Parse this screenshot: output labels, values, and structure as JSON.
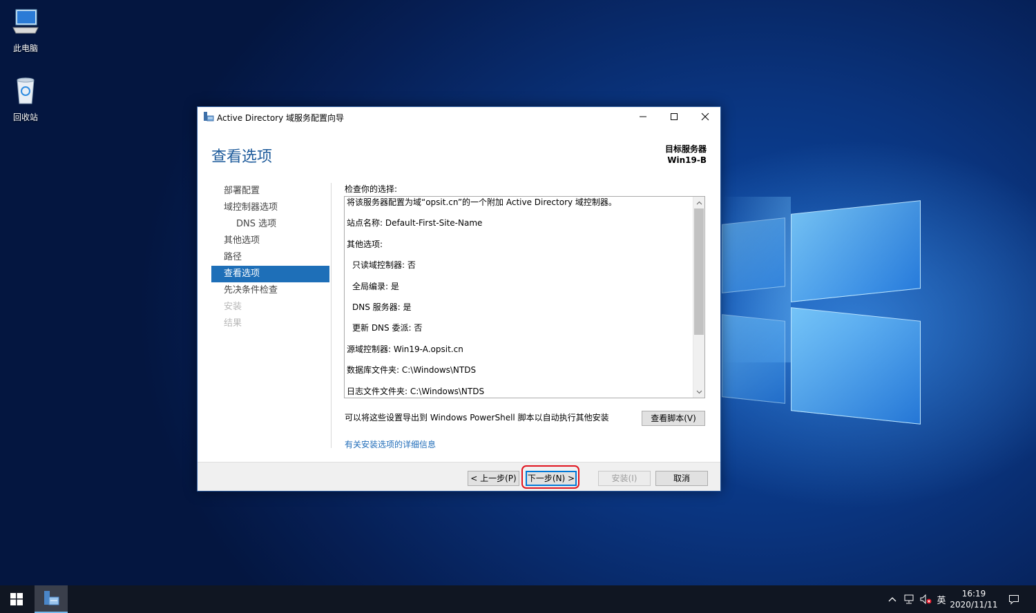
{
  "desktop": {
    "icons": [
      {
        "label": "此电脑",
        "icon": "computer-icon"
      },
      {
        "label": "回收站",
        "icon": "recycle-bin-icon"
      }
    ]
  },
  "window": {
    "title": "Active Directory 域服务配置向导",
    "heading": "查看选项",
    "target_server_label": "目标服务器",
    "target_server_name": "Win19-B",
    "nav_items": [
      {
        "label": "部署配置",
        "state": "normal"
      },
      {
        "label": "域控制器选项",
        "state": "normal"
      },
      {
        "label": "DNS 选项",
        "state": "sub"
      },
      {
        "label": "其他选项",
        "state": "normal"
      },
      {
        "label": "路径",
        "state": "normal"
      },
      {
        "label": "查看选项",
        "state": "active"
      },
      {
        "label": "先决条件检查",
        "state": "normal"
      },
      {
        "label": "安装",
        "state": "disabled"
      },
      {
        "label": "结果",
        "state": "disabled"
      }
    ],
    "review_label": "检查你的选择:",
    "review_lines": [
      "将该服务器配置为域“opsit.cn”的一个附加 Active Directory 域控制器。",
      "站点名称: Default-First-Site-Name",
      "其他选项:",
      "只读域控制器: 否",
      "全局编录: 是",
      "DNS 服务器: 是",
      "更新 DNS 委派: 否",
      "源域控制器: Win19-A.opsit.cn",
      "数据库文件夹: C:\\Windows\\NTDS",
      "日志文件文件夹: C:\\Windows\\NTDS"
    ],
    "export_text": "可以将这些设置导出到 Windows PowerShell 脚本以自动执行其他安装",
    "view_script_button": "查看脚本(V)",
    "more_info_link": "有关安装选项的详细信息",
    "buttons": {
      "prev": "< 上一步(P)",
      "next": "下一步(N) >",
      "install": "安装(I)",
      "cancel": "取消"
    }
  },
  "taskbar": {
    "ime": "英",
    "time": "16:19",
    "date": "2020/11/11"
  },
  "colors": {
    "accent": "#1e6fb8",
    "heading": "#1e5b9b",
    "highlight": "#e0141e"
  }
}
